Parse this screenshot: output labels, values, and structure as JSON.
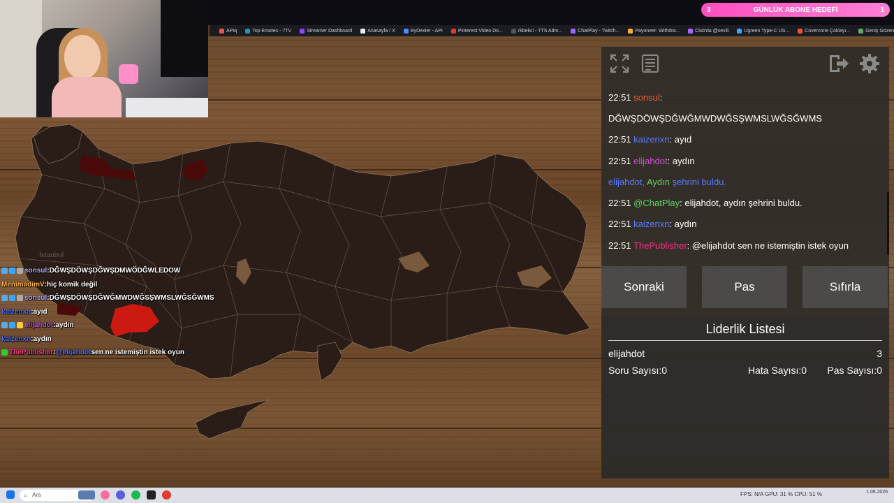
{
  "goal": {
    "count_left": "3",
    "label": "GÜNLÜK ABONE HEDEFİ",
    "count_right": "1"
  },
  "bookmarks": [
    {
      "label": "APIq",
      "color": "#e54"
    },
    {
      "label": "Top Emotes - 7TV",
      "color": "#29a"
    },
    {
      "label": "Streamer Dashboard",
      "color": "#94f"
    },
    {
      "label": "Anasayfa / X",
      "color": "#eee"
    },
    {
      "label": "ByDexter - API",
      "color": "#58f"
    },
    {
      "label": "Pinterest Video Do...",
      "color": "#e33"
    },
    {
      "label": "rkbekci - TTS Adm...",
      "color": "#555"
    },
    {
      "label": "ChatPlay - Twitch...",
      "color": "#96f"
    },
    {
      "label": "Payoneer: Withdra...",
      "color": "#fa3"
    },
    {
      "label": "Club'da @sevili",
      "color": "#a6f"
    },
    {
      "label": "Ugreen Type-C US...",
      "color": "#3af"
    },
    {
      "label": "Coverzone Çoklayı...",
      "color": "#e53"
    },
    {
      "label": "Geniş Gözenekler...",
      "color": "#6a6"
    }
  ],
  "map": {
    "istanbul_label": "İstanbul"
  },
  "overlay_chat": [
    {
      "user": "sonsul",
      "user_color": "#b8a8ff",
      "text": "DĞWŞDÖWŞDĞWŞDMWÖDĞWLEDOW",
      "badges": [
        "#5ae",
        "#3af",
        "#aaa"
      ]
    },
    {
      "user": "MenimadimV",
      "user_color": "#ffb347",
      "text": "hiç komik değil",
      "badges": []
    },
    {
      "user": "sonsul",
      "user_color": "#b8a8ff",
      "text": "DĞWŞDÖWŞDĞWĞMWDWĞSŞWMSLWĞSĞWMS",
      "badges": [
        "#5ae",
        "#3af",
        "#aaa"
      ]
    },
    {
      "user": "kaizenxn",
      "user_color": "#4d6bff",
      "text": "ayıd",
      "badges": []
    },
    {
      "user": "elijahdot",
      "user_color": "#c050e0",
      "text": "aydın",
      "badges": [
        "#5ae",
        "#3af",
        "#fc3"
      ]
    },
    {
      "user": "kaizenxn",
      "user_color": "#4d6bff",
      "text": "aydın",
      "badges": []
    },
    {
      "user": "ThePublisher",
      "user_color": "#ff2d8a",
      "mention": "@elijahdot",
      "text": "sen ne istemiştin istek oyun",
      "badges": [
        "#3c3"
      ]
    }
  ],
  "panel": {
    "icons": [
      "fullscreen-icon",
      "list-icon",
      "exit-icon",
      "gear-icon"
    ],
    "messages": [
      {
        "time": "22:51",
        "user": "sonsul",
        "user_color": "#e0603a",
        "text": ""
      },
      {
        "time": "",
        "user": "",
        "user_color": "#fff",
        "text": "DĞWŞDÖWŞDĞWĞMWDWĞSŞWMSLWĞSĞWMS"
      },
      {
        "time": "22:51",
        "user": "kaizenxn",
        "user_color": "#5b7bff",
        "text": "ayıd"
      },
      {
        "time": "22:51",
        "user": "elijahdot",
        "user_color": "#d24fe0",
        "text": "aydın"
      },
      {
        "time": "22:51",
        "user": "@ChatPlay",
        "user_color": "#5fd35f",
        "text": "elijahdot, aydın şehrini buldu."
      },
      {
        "time": "22:51",
        "user": "kaizenxn",
        "user_color": "#5b7bff",
        "text": "aydın"
      },
      {
        "time": "22:51",
        "user": "ThePublisher",
        "user_color": "#ff2d8a",
        "text": "@elijahdot sen ne istemiştin istek oyun"
      }
    ],
    "system_message": {
      "user": "elijahdot",
      "user_color": "#5b7bff",
      "city": "Aydın",
      "city_color": "#5fd35f",
      "suffix": " şehrini buldu.",
      "suffix_color": "#5b7bff"
    }
  },
  "actions": {
    "next": "Sonraki",
    "pass": "Pas",
    "reset": "Sıfırla"
  },
  "leaderboard": {
    "title": "Liderlik Listesi",
    "player": "elijahdot",
    "score": "3",
    "questions": "Soru Sayısı:0",
    "errors": "Hata Sayısı:0",
    "passes": "Pas Sayısı:0"
  },
  "taskbar": {
    "search_placeholder": "Ara",
    "stats": "FPS: N/A   GPU: 31 %   CPU: 51 %",
    "time": "",
    "date": "1.06.2026"
  }
}
